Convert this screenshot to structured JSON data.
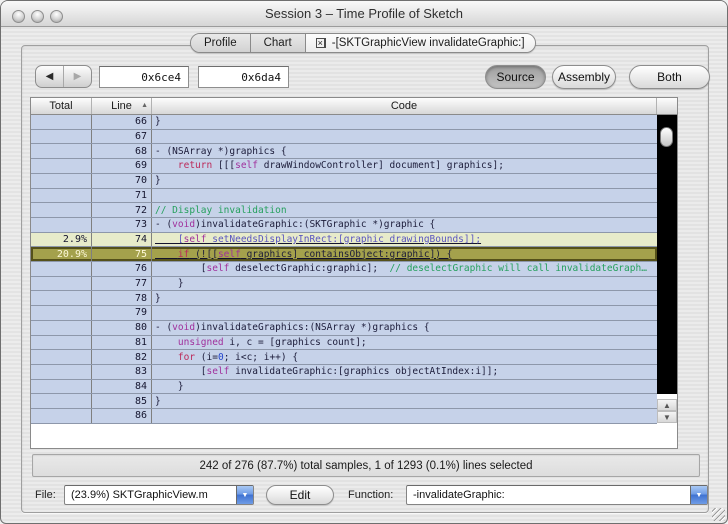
{
  "window": {
    "title": "Session 3 – Time Profile of Sketch"
  },
  "tabs": {
    "items": [
      {
        "label": "Profile"
      },
      {
        "label": "Chart"
      },
      {
        "label": "-[SKTGraphicView invalidateGraphic:]",
        "closable": true,
        "active": true
      }
    ]
  },
  "icons": {
    "close_tab": "×",
    "sort_asc": "▲",
    "back": "◀",
    "forward": "▶",
    "dropdown": "▼",
    "scroll_up": "▲",
    "scroll_down": "▼"
  },
  "toolbar": {
    "address_start": "0x6ce4",
    "address_end": "0x6da4",
    "view_buttons": [
      {
        "label": "Source",
        "active": true
      },
      {
        "label": "Assembly",
        "active": false
      },
      {
        "label": "Both",
        "active": false
      }
    ]
  },
  "table": {
    "columns": [
      "Total",
      "Line",
      "Code"
    ],
    "sort_column": "Line",
    "sort_direction": "ascending",
    "rows": [
      {
        "total": "",
        "line": "66",
        "tokens": [
          [
            "}",
            "plain"
          ]
        ]
      },
      {
        "total": "",
        "line": "67",
        "tokens": []
      },
      {
        "total": "",
        "line": "68",
        "tokens": [
          [
            "- (NSArray *)graphics {",
            "plain"
          ]
        ]
      },
      {
        "total": "",
        "line": "69",
        "tokens": [
          [
            "    ",
            "plain"
          ],
          [
            "return",
            "kw"
          ],
          [
            " [[[",
            "plain"
          ],
          [
            "self",
            "obj"
          ],
          [
            " drawWindowController] document] graphics];",
            "plain"
          ]
        ]
      },
      {
        "total": "",
        "line": "70",
        "tokens": [
          [
            "}",
            "plain"
          ]
        ]
      },
      {
        "total": "",
        "line": "71",
        "tokens": []
      },
      {
        "total": "",
        "line": "72",
        "tokens": [
          [
            "// Display invalidation",
            "com"
          ]
        ]
      },
      {
        "total": "",
        "line": "73",
        "tokens": [
          [
            "- (",
            "plain"
          ],
          [
            "void",
            "obj"
          ],
          [
            ")invalidateGraphic:(SKTGraphic *)graphic {",
            "plain"
          ]
        ]
      },
      {
        "total": "2.9%",
        "line": "74",
        "style": "sample",
        "underline": true,
        "tokens": [
          [
            "    [",
            "link"
          ],
          [
            "self",
            "obj"
          ],
          [
            " setNeedsDisplayInRect:[graphic drawingBounds]];",
            "link"
          ]
        ]
      },
      {
        "total": "20.9%",
        "line": "75",
        "style": "selected",
        "underline": true,
        "tokens": [
          [
            "    ",
            "plain"
          ],
          [
            "if",
            "kw"
          ],
          [
            " (![[",
            "plain"
          ],
          [
            "self",
            "obj"
          ],
          [
            " graphics] containsObject:graphic]) {",
            "plain"
          ]
        ]
      },
      {
        "total": "",
        "line": "76",
        "tokens": [
          [
            "        [",
            "plain"
          ],
          [
            "self",
            "obj"
          ],
          [
            " deselectGraphic:graphic];",
            "plain"
          ],
          [
            "  // deselectGraphic will call invalidateGraph…",
            "com"
          ]
        ]
      },
      {
        "total": "",
        "line": "77",
        "tokens": [
          [
            "    }",
            "plain"
          ]
        ]
      },
      {
        "total": "",
        "line": "78",
        "tokens": [
          [
            "}",
            "plain"
          ]
        ]
      },
      {
        "total": "",
        "line": "79",
        "tokens": []
      },
      {
        "total": "",
        "line": "80",
        "tokens": [
          [
            "- (",
            "plain"
          ],
          [
            "void",
            "obj"
          ],
          [
            ")invalidateGraphics:(NSArray *)graphics {",
            "plain"
          ]
        ]
      },
      {
        "total": "",
        "line": "81",
        "tokens": [
          [
            "    ",
            "plain"
          ],
          [
            "unsigned",
            "obj"
          ],
          [
            " i, c = [graphics count];",
            "plain"
          ]
        ]
      },
      {
        "total": "",
        "line": "82",
        "tokens": [
          [
            "    ",
            "plain"
          ],
          [
            "for",
            "kw"
          ],
          [
            " (i=",
            "plain"
          ],
          [
            "0",
            "num"
          ],
          [
            "; i<c; i++) {",
            "plain"
          ]
        ]
      },
      {
        "total": "",
        "line": "83",
        "tokens": [
          [
            "        [",
            "plain"
          ],
          [
            "self",
            "obj"
          ],
          [
            " invalidateGraphic:[graphics objectAtIndex:i]];",
            "plain"
          ]
        ]
      },
      {
        "total": "",
        "line": "84",
        "tokens": [
          [
            "    }",
            "plain"
          ]
        ]
      },
      {
        "total": "",
        "line": "85",
        "tokens": [
          [
            "}",
            "plain"
          ]
        ]
      },
      {
        "total": "",
        "line": "86",
        "tokens": []
      }
    ]
  },
  "status_bar": {
    "text": "242 of 276 (87.7%) total samples, 1 of 1293 (0.1%) lines selected"
  },
  "footer": {
    "file_label": "File:",
    "file_value": "(23.9%) SKTGraphicView.m",
    "edit_label": "Edit",
    "function_label": "Function:",
    "function_value": "-invalidateGraphic:"
  },
  "colors": {
    "accent_blue": "#4a7cd8",
    "row_blue": "#c6d2e9",
    "sample_row_bg": "#e7ebca",
    "selected_row_bg": "#a4a14c",
    "selected_row_border": "#55511a",
    "selected_row_text": "#fdf8d8",
    "scroll_track": "#000000",
    "syntax": {
      "plain": "#1c1c3a",
      "kw": "#bb2a5a",
      "obj": "#a0309c",
      "com": "#26a05e",
      "num": "#2244cc",
      "link": "#5a55c0"
    }
  }
}
